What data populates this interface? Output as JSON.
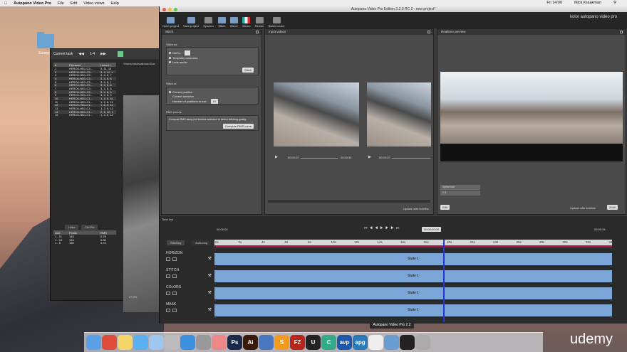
{
  "menubar": {
    "apple": "",
    "app": "Autopano Video Pro",
    "items": [
      "File",
      "Edit",
      "Video views",
      "Help"
    ],
    "clock": "Fri 14:00",
    "user": "Mick Kraakman"
  },
  "desktop": {
    "folder_label": "Example"
  },
  "back_window": {
    "title": "Current task",
    "counter": "1-4",
    "path": "/Users/mickraakman/Doc",
    "columns": [
      "#",
      "Filename",
      "Linked t"
    ],
    "rows": [
      [
        "1",
        "HERO4-HD1-C3...",
        "3, 11, 13"
      ],
      [
        "2",
        "HERO4-HD1-C3...",
        "3, 4, 11, 1"
      ],
      [
        "3",
        "HERO4-HD1-C3...",
        "3, 4, 6, 7"
      ],
      [
        "4",
        "HERO4-HD1-C3...",
        "3, 4, 5, 6"
      ],
      [
        "5",
        "HERO4-HD1-C3...",
        "3, 4, 6, 7"
      ],
      [
        "6",
        "HERO4-HD1-C3...",
        "3, 4, 6, 8"
      ],
      [
        "7",
        "HERO4-HD1-C3...",
        "3, 4, 6, 8"
      ],
      [
        "8",
        "HERO4-HD1-C3...",
        "3, 4, 8, 9"
      ],
      [
        "9",
        "HERO4-HD1-C3...",
        "3, 4, 8, 9"
      ],
      [
        "10",
        "HERO4-HD1-C1...",
        "1, 4, 9, 11"
      ],
      [
        "11",
        "HERO4-HD1-C1...",
        "1, 2, 8, 13"
      ],
      [
        "12",
        "HERO4-HD1-C1...",
        "1, 6, 9, 11"
      ],
      [
        "13",
        "HERO4-HD1-C1...",
        "1, 2, 9, 12"
      ],
      [
        "14",
        "HERO4-HD1-C1...",
        "2, 9, 10, 1"
      ],
      [
        "15",
        "HERO4-HD1-C1...",
        "1, 3, 8, 12"
      ]
    ],
    "tabs": [
      "Links",
      "Ctrl Pts"
    ],
    "table2_cols": [
      "Line",
      "Points",
      "RMS"
    ],
    "table2_rows": [
      [
        "1 - 11",
        "145",
        "0.78"
      ],
      [
        "1 - 13",
        "194",
        "0.59"
      ],
      [
        "1 - 5",
        "180",
        "3.74"
      ]
    ],
    "zoom": "67.8%"
  },
  "window": {
    "title": "Autopano Video Pro Edition 2.2.0 RC 2 - new project*",
    "brand": "kolor autopano video pro",
    "toolbar": [
      "Open project",
      "Save project",
      "Synchro",
      "Stitch",
      "Blend",
      "Stereo",
      "Render",
      "Batch render"
    ]
  },
  "stitch_panel": {
    "title": "Stitch",
    "stitch_as_label": "Stitch as",
    "gopro": "GoPro",
    "template": "Template panorama",
    "lens": "Lens model",
    "stitch_btn": "Stitch",
    "stitch_at_label": "Stitch at",
    "current_pos": "Current position",
    "current_sel": "Current selection",
    "num_pos": "Number of positions to use",
    "num_val": "10",
    "rms_label": "RMS curves",
    "rms_desc": "Compute RMS along the timeline selection to detect stitching quality.",
    "rms_btn": "Compute RMS curve"
  },
  "input_panel": {
    "title": "Input videos",
    "t1": "00:00:20",
    "t2": "00:00:34",
    "t3": "00:00:20",
    "update": "Update with timeline"
  },
  "preview_panel": {
    "title": "Realtime preview",
    "projection": "Spherical",
    "projection2": "2:1",
    "edit_btn": "Edit",
    "update": "Update with timeline",
    "res": "2048"
  },
  "timeline": {
    "title": "Time line",
    "start": "00:00:00",
    "end": "00:00:34",
    "timecode": "00:00:20:09",
    "tabs": [
      "Stitching",
      "Authoring"
    ],
    "ticks": [
      "0s",
      "2s",
      "4s",
      "6s",
      "8s",
      "10s",
      "12s",
      "14s",
      "16s",
      "18s",
      "20s",
      "22s",
      "24s",
      "26s",
      "28s",
      "30s",
      "32s",
      "34s"
    ],
    "tracks": [
      {
        "label": "HORIZON",
        "state": "State 1"
      },
      {
        "label": "STITCH",
        "state": "State 1"
      },
      {
        "label": "COLORS",
        "state": "State 1"
      },
      {
        "label": "MASK",
        "state": "State 1"
      }
    ]
  },
  "dock": {
    "tooltip": "Autopano Video Pro 2.2",
    "apps": [
      "Finder",
      "Chrome",
      "Notes",
      "Messages",
      "Preview",
      "Launchpad",
      "App Store",
      "Settings",
      "Photos",
      "Ps",
      "Ai",
      "Finder2",
      "Sublime",
      "FileZilla",
      "Unity",
      "CS",
      "avp",
      "apg",
      "Document",
      "Folder",
      "Terminal",
      "Trash"
    ]
  },
  "watermark": "udemy"
}
